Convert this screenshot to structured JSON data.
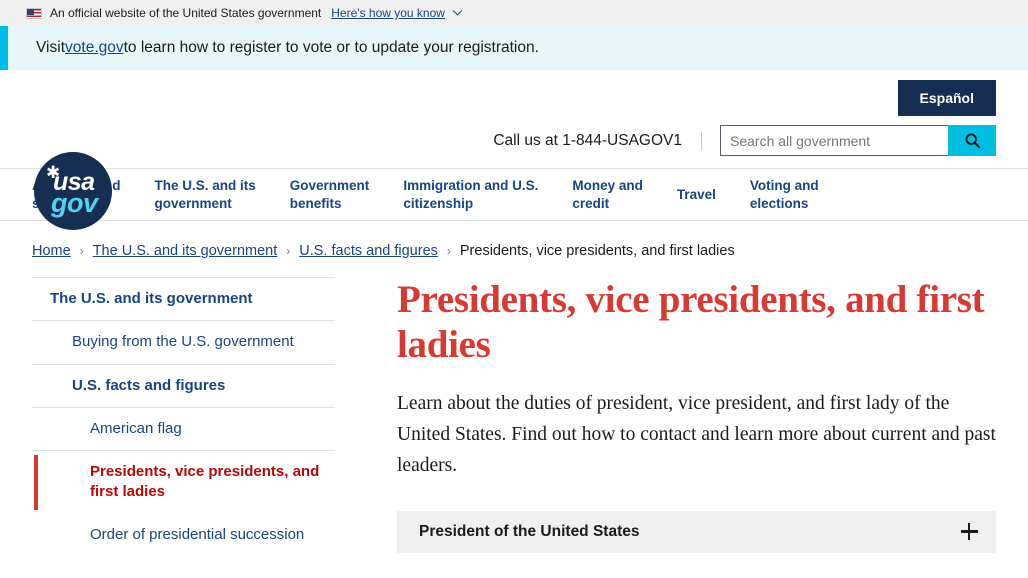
{
  "gov_banner": {
    "flag_icon": "us-flag-icon",
    "text": "An official website of the United States government",
    "link": "Here's how you know",
    "chevron_icon": "chevron-down-icon"
  },
  "vote_banner": {
    "prefix": "Visit ",
    "link": "vote.gov",
    "suffix": " to learn how to register to vote or to update your registration.",
    "accent_color": "#00bde3"
  },
  "header": {
    "logo": {
      "name": "usagov-logo",
      "usa": "usa",
      "gov": "gov",
      "star_icon": "star-icon",
      "bg_color": "#162e51",
      "gov_color": "#4fd3f0"
    },
    "espanol_label": "Español",
    "call_us": "Call us at 1-844-USAGOV1",
    "search": {
      "placeholder": "Search all government",
      "value": "",
      "button_icon": "search-icon",
      "button_color": "#00bde3"
    }
  },
  "nav": {
    "items": [
      {
        "label": "All topics and\nservices"
      },
      {
        "label": "The U.S. and its\ngovernment"
      },
      {
        "label": "Government\nbenefits"
      },
      {
        "label": "Immigration and U.S.\ncitizenship"
      },
      {
        "label": "Money and\ncredit"
      },
      {
        "label": "Travel"
      },
      {
        "label": "Voting and\nelections"
      }
    ]
  },
  "breadcrumb": {
    "separator": "›",
    "items": [
      {
        "label": "Home",
        "link": true
      },
      {
        "label": "The U.S. and its government",
        "link": true
      },
      {
        "label": "U.S. facts and figures",
        "link": true
      },
      {
        "label": "Presidents, vice presidents, and first ladies",
        "link": false
      }
    ]
  },
  "sidebar": {
    "items": [
      {
        "label": "The U.S. and its government",
        "level": 1,
        "active": false
      },
      {
        "label": "Buying from the U.S. government",
        "level": 2,
        "active": false
      },
      {
        "label": "U.S. facts and figures",
        "level": 2,
        "active": false
      },
      {
        "label": "American flag",
        "level": 3,
        "active": false
      },
      {
        "label": "Presidents, vice presidents, and first ladies",
        "level": 3,
        "active": true
      },
      {
        "label": "Order of presidential succession",
        "level": 3,
        "active": false
      }
    ],
    "active_color": "#b50909",
    "active_bar_color": "#d83933"
  },
  "main": {
    "title": "Presidents, vice presidents, and first ladies",
    "title_color": "#d83933",
    "intro": "Learn about the duties of president, vice president, and first lady of the United States. Find out how to contact and learn more about current and past leaders.",
    "accordion": {
      "title": "President of the United States",
      "toggle_icon": "plus-icon",
      "expanded": false
    }
  }
}
